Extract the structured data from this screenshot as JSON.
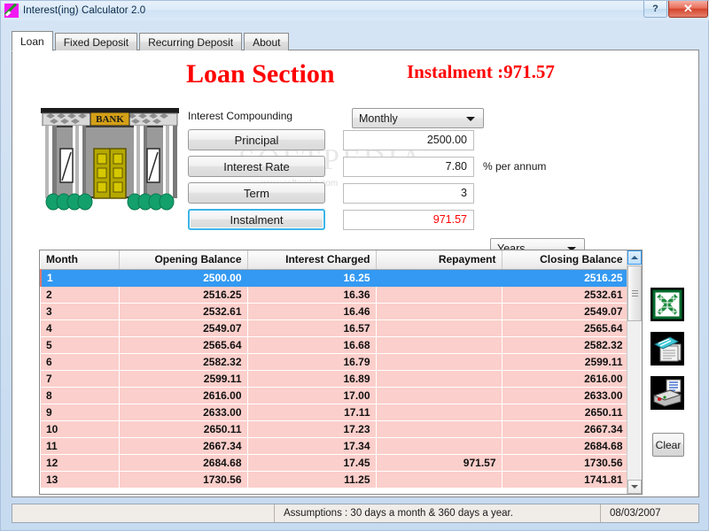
{
  "window": {
    "title": "Interest(ing) Calculator 2.0",
    "app_icon": "calculator-icon",
    "help_label": "?",
    "close_label": "✕"
  },
  "tabs": [
    {
      "label": "Loan",
      "active": true
    },
    {
      "label": "Fixed Deposit",
      "active": false
    },
    {
      "label": "Recurring Deposit",
      "active": false
    },
    {
      "label": "About",
      "active": false
    }
  ],
  "headings": {
    "section_title": "Loan Section",
    "instalment_headline": "Instalment :971.57"
  },
  "watermark": {
    "main": "SOFTPEDIA",
    "sub": "www.softpedia.com"
  },
  "form": {
    "compounding_label": "Interest Compounding",
    "compounding_value": "Monthly",
    "principal_label": "Principal",
    "principal_value": "2500.00",
    "rate_label": "Interest Rate",
    "rate_value": "7.80",
    "rate_suffix": "% per annum",
    "term_label": "Term",
    "term_value": "3",
    "term_unit": "Years",
    "instalment_label": "Instalment",
    "instalment_value": "971.57"
  },
  "table": {
    "columns": [
      "Month",
      "Opening Balance",
      "Interest Charged",
      "Repayment",
      "Closing Balance"
    ],
    "rows": [
      {
        "month": "1",
        "opening": "2500.00",
        "interest": "16.25",
        "repayment": "",
        "closing": "2516.25",
        "selected": true
      },
      {
        "month": "2",
        "opening": "2516.25",
        "interest": "16.36",
        "repayment": "",
        "closing": "2532.61",
        "selected": false
      },
      {
        "month": "3",
        "opening": "2532.61",
        "interest": "16.46",
        "repayment": "",
        "closing": "2549.07",
        "selected": false
      },
      {
        "month": "4",
        "opening": "2549.07",
        "interest": "16.57",
        "repayment": "",
        "closing": "2565.64",
        "selected": false
      },
      {
        "month": "5",
        "opening": "2565.64",
        "interest": "16.68",
        "repayment": "",
        "closing": "2582.32",
        "selected": false
      },
      {
        "month": "6",
        "opening": "2582.32",
        "interest": "16.79",
        "repayment": "",
        "closing": "2599.11",
        "selected": false
      },
      {
        "month": "7",
        "opening": "2599.11",
        "interest": "16.89",
        "repayment": "",
        "closing": "2616.00",
        "selected": false
      },
      {
        "month": "8",
        "opening": "2616.00",
        "interest": "17.00",
        "repayment": "",
        "closing": "2633.00",
        "selected": false
      },
      {
        "month": "9",
        "opening": "2633.00",
        "interest": "17.11",
        "repayment": "",
        "closing": "2650.11",
        "selected": false
      },
      {
        "month": "10",
        "opening": "2650.11",
        "interest": "17.23",
        "repayment": "",
        "closing": "2667.34",
        "selected": false
      },
      {
        "month": "11",
        "opening": "2667.34",
        "interest": "17.34",
        "repayment": "",
        "closing": "2684.68",
        "selected": false
      },
      {
        "month": "12",
        "opening": "2684.68",
        "interest": "17.45",
        "repayment": "971.57",
        "closing": "1730.56",
        "selected": false
      },
      {
        "month": "13",
        "opening": "1730.56",
        "interest": "11.25",
        "repayment": "",
        "closing": "1741.81",
        "selected": false
      }
    ]
  },
  "actions": {
    "excel_icon": "excel-export-icon",
    "notes_icon": "text-export-icon",
    "print_icon": "print-icon",
    "clear_label": "Clear"
  },
  "statusbar": {
    "left": "",
    "assumptions": "Assumptions : 30 days a month & 360 days a year.",
    "date": "08/03/2007"
  },
  "colors": {
    "accent_red": "#ff0000",
    "row_pink": "#fbcfcb",
    "selection_blue": "#3399f2",
    "window_chrome": "#cfe0f2"
  }
}
